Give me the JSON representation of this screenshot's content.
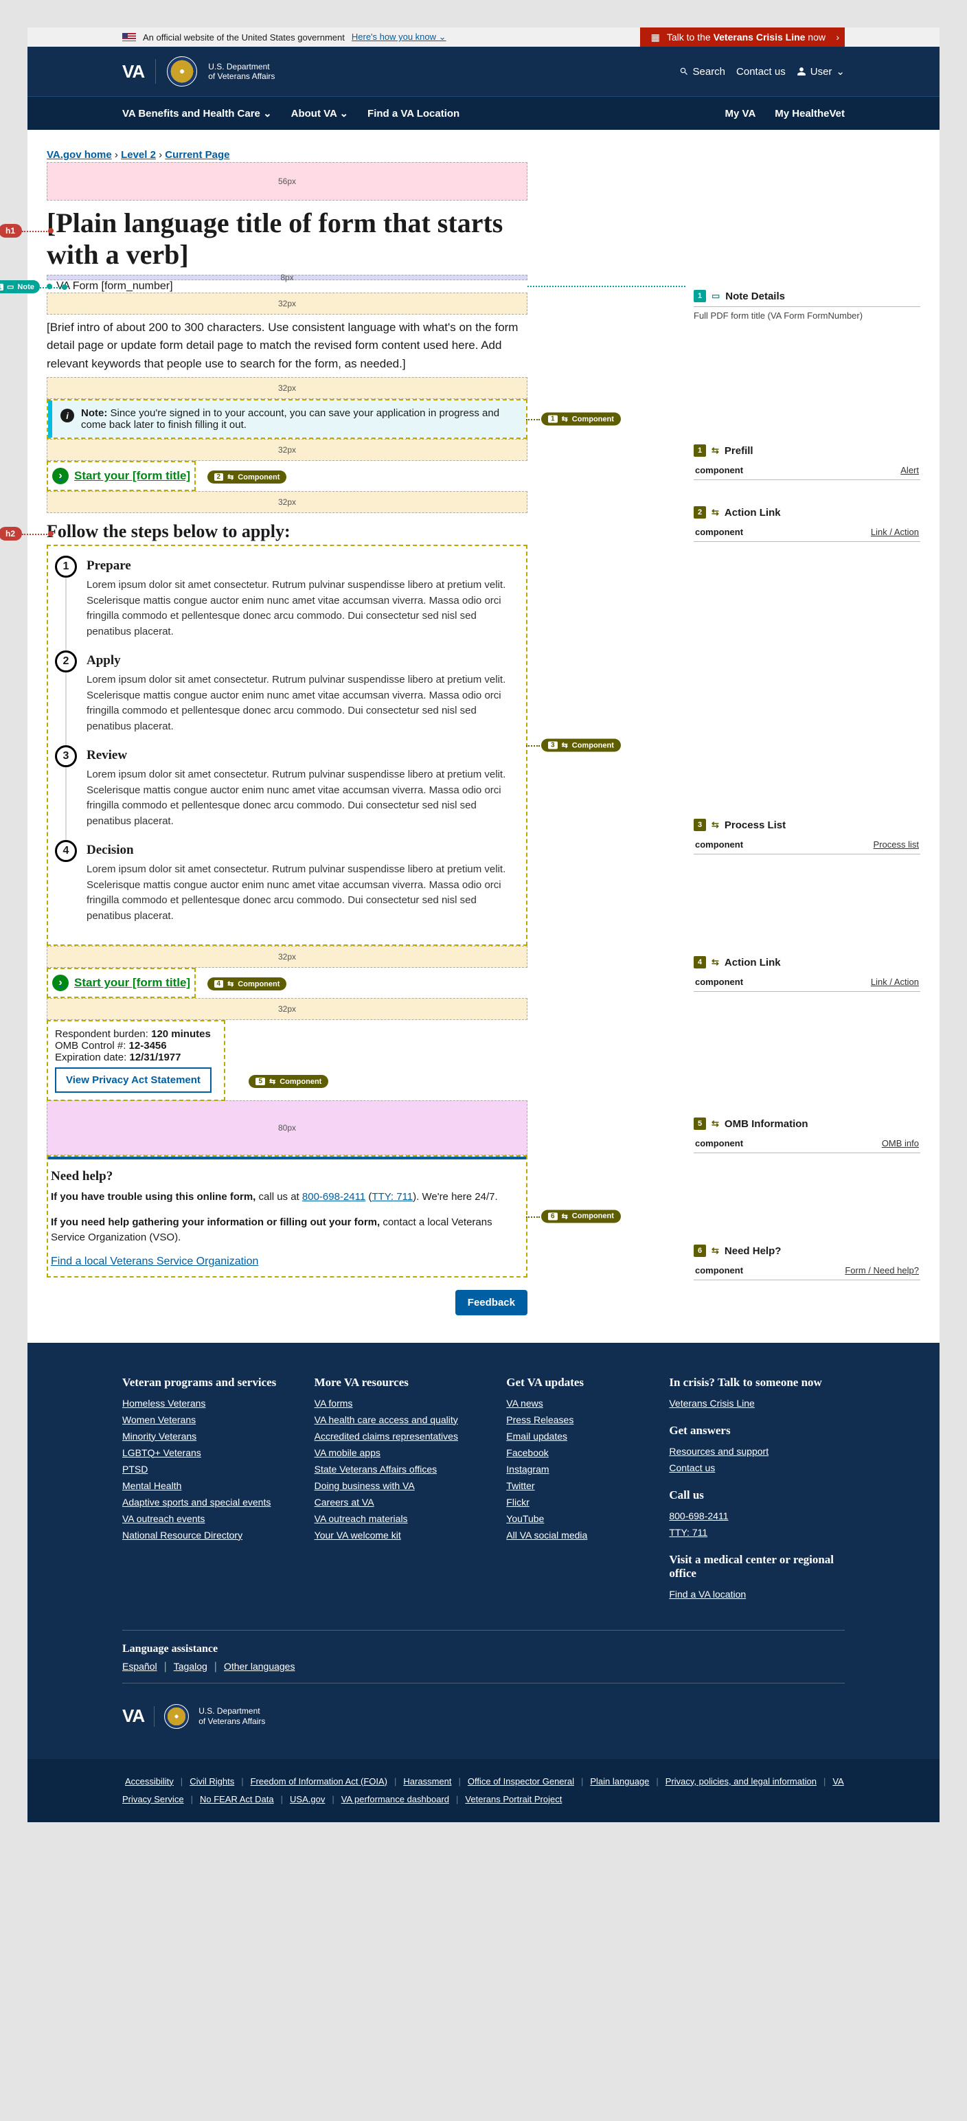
{
  "gov": {
    "text": "An official website of the United States government",
    "how": "Here's how you know"
  },
  "crisis": {
    "prefix": "Talk to the ",
    "bold": "Veterans Crisis Line",
    "suffix": " now"
  },
  "header": {
    "mark": "VA",
    "dept_l1": "U.S. Department",
    "dept_l2": "of Veterans Affairs",
    "search": "Search",
    "contact": "Contact us",
    "user": "User"
  },
  "nav": {
    "benefits": "VA Benefits and Health Care",
    "about": "About VA",
    "find": "Find a VA Location",
    "myva": "My VA",
    "myhealth": "My HealtheVet"
  },
  "breadcrumb": {
    "home": "VA.gov home",
    "l2": "Level 2",
    "cur": "Current Page"
  },
  "spacers": {
    "s56": "56px",
    "s32": "32px",
    "s8": "8px",
    "s80": "80px"
  },
  "hpills": {
    "h1": "h1",
    "h2": "h2"
  },
  "notePill": "Note",
  "title": "[Plain language title of form that starts with a verb]",
  "subtitle": "VA Form [form_number]",
  "intro": "[Brief intro of about 200 to 300 characters. Use consistent language with what's on the form detail page or update form detail page to match the revised form content used here. Add relevant keywords that people use to search for the form, as needed.]",
  "alert": {
    "bold": "Note:",
    "text": " Since you're signed in to your account, you can save your application in progress and come back later to finish filling it out."
  },
  "action": "Start your [form title]",
  "componentBadge": "Component",
  "stepsHeading": "Follow the steps below to apply:",
  "steps": [
    {
      "h": "Prepare",
      "p": "Lorem ipsum dolor sit amet consectetur. Rutrum pulvinar suspendisse libero at pretium velit. Scelerisque mattis congue auctor enim nunc amet vitae accumsan viverra. Massa odio orci fringilla commodo et pellentesque donec arcu commodo. Dui consectetur sed nisl sed penatibus placerat."
    },
    {
      "h": "Apply",
      "p": "Lorem ipsum dolor sit amet consectetur. Rutrum pulvinar suspendisse libero at pretium velit. Scelerisque mattis congue auctor enim nunc amet vitae accumsan viverra. Massa odio orci fringilla commodo et pellentesque donec arcu commodo. Dui consectetur sed nisl sed penatibus placerat."
    },
    {
      "h": "Review",
      "p": "Lorem ipsum dolor sit amet consectetur. Rutrum pulvinar suspendisse libero at pretium velit. Scelerisque mattis congue auctor enim nunc amet vitae accumsan viverra. Massa odio orci fringilla commodo et pellentesque donec arcu commodo. Dui consectetur sed nisl sed penatibus placerat."
    },
    {
      "h": "Decision",
      "p": "Lorem ipsum dolor sit amet consectetur. Rutrum pulvinar suspendisse libero at pretium velit. Scelerisque mattis congue auctor enim nunc amet vitae accumsan viverra. Massa odio orci fringilla commodo et pellentesque donec arcu commodo. Dui consectetur sed nisl sed penatibus placerat."
    }
  ],
  "omb": {
    "burden_l": "Respondent burden:",
    "burden_v": "120 minutes",
    "control_l": "OMB Control #:",
    "control_v": "12-3456",
    "exp_l": "Expiration date:",
    "exp_v": "12/31/1977",
    "privacy": "View Privacy Act Statement"
  },
  "need": {
    "h": "Need help?",
    "p1a": "If you have trouble using this online form,",
    "p1b": " call us at ",
    "tel": "800-698-2411",
    "tty_label": "TTY: 711",
    "p1c": "). We're here 24/7.",
    "p2a": "If you need help gathering your information or filling out your form,",
    "p2b": " contact a local Veterans Service Organization (VSO).",
    "link": "Find a local Veterans Service Organization"
  },
  "feedback": "Feedback",
  "rail": {
    "noteDetails": {
      "title": "Note Details",
      "body": "Full PDF form title (VA Form FormNumber)"
    },
    "items": [
      {
        "n": "1",
        "title": "Prefill",
        "k": "component",
        "v": "Alert"
      },
      {
        "n": "2",
        "title": "Action Link",
        "k": "component",
        "v": "Link / Action"
      },
      {
        "n": "3",
        "title": "Process List",
        "k": "component",
        "v": "Process list"
      },
      {
        "n": "4",
        "title": "Action Link",
        "k": "component",
        "v": "Link / Action"
      },
      {
        "n": "5",
        "title": "OMB Information",
        "k": "component",
        "v": "OMB info"
      },
      {
        "n": "6",
        "title": "Need Help?",
        "k": "component",
        "v": "Form / Need help?"
      }
    ]
  },
  "footer": {
    "col1_h": "Veteran programs and services",
    "col1": [
      "Homeless Veterans",
      "Women Veterans",
      "Minority Veterans",
      "LGBTQ+ Veterans",
      "PTSD",
      "Mental Health",
      "Adaptive sports and special events",
      "VA outreach events",
      "National Resource Directory"
    ],
    "col2_h": "More VA resources",
    "col2": [
      "VA forms",
      "VA health care access and quality",
      "Accredited claims representatives",
      "VA mobile apps",
      "State Veterans Affairs offices",
      "Doing business with VA",
      "Careers at VA",
      "VA outreach materials",
      "Your VA welcome kit"
    ],
    "col3_h": "Get VA updates",
    "col3": [
      "VA news",
      "Press Releases",
      "Email updates",
      "Facebook",
      "Instagram",
      "Twitter",
      "Flickr",
      "YouTube",
      "All VA social media"
    ],
    "col4_h1": "In crisis? Talk to someone now",
    "col4_1": [
      "Veterans Crisis Line"
    ],
    "col4_h2": "Get answers",
    "col4_2": [
      "Resources and support",
      "Contact us"
    ],
    "col4_h3": "Call us",
    "col4_3": [
      "800-698-2411",
      "TTY: 711"
    ],
    "col4_h4": "Visit a medical center or regional office",
    "col4_4": [
      "Find a VA location"
    ],
    "lang_h": "Language assistance",
    "lang": [
      "Español",
      "Tagalog",
      "Other languages"
    ],
    "legal": [
      "Accessibility",
      "Civil Rights",
      "Freedom of Information Act (FOIA)",
      "Harassment",
      "Office of Inspector General",
      "Plain language",
      "Privacy, policies, and legal information",
      "VA Privacy Service",
      "No FEAR Act Data",
      "USA.gov",
      "VA performance dashboard",
      "Veterans Portrait Project"
    ]
  }
}
